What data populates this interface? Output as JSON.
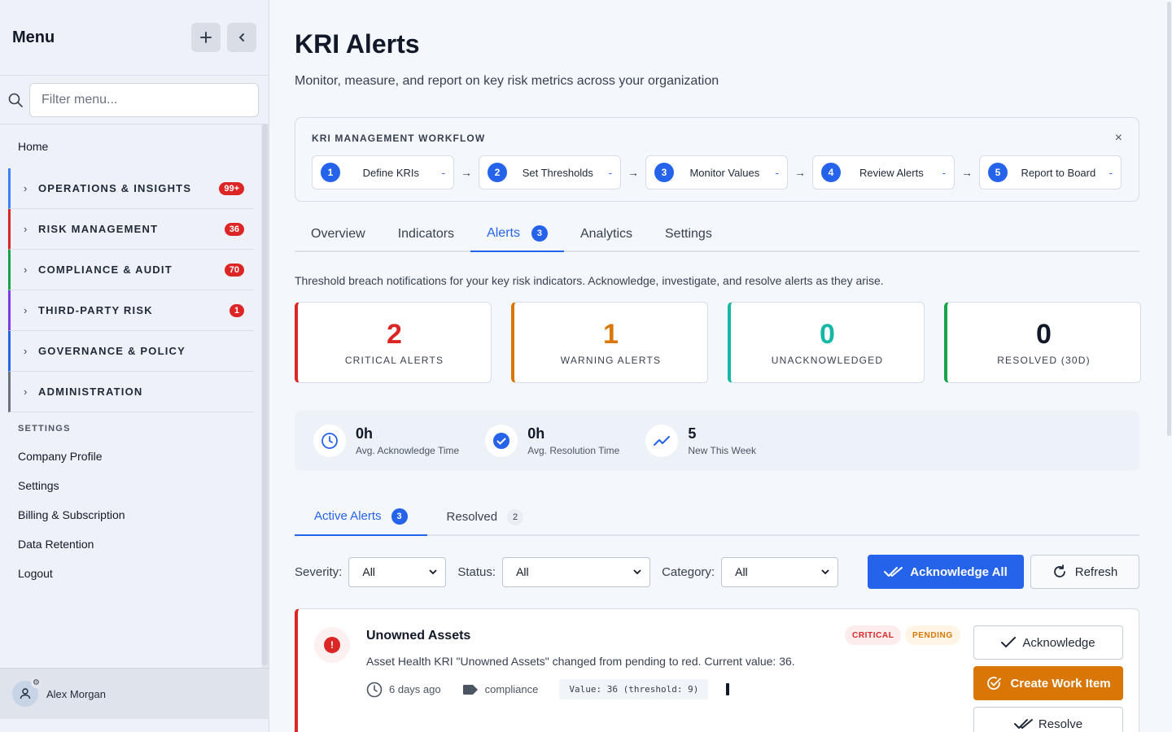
{
  "sidebar": {
    "title": "Menu",
    "filter_placeholder": "Filter menu...",
    "home": "Home",
    "groups": [
      {
        "label": "OPERATIONS & INSIGHTS",
        "badge": "99+",
        "color": "#3b82f6"
      },
      {
        "label": "RISK MANAGEMENT",
        "badge": "36",
        "color": "#dc2626"
      },
      {
        "label": "COMPLIANCE & AUDIT",
        "badge": "70",
        "color": "#16a34a"
      },
      {
        "label": "THIRD-PARTY RISK",
        "badge": "1",
        "color": "#7c3aed"
      },
      {
        "label": "GOVERNANCE & POLICY",
        "badge": "",
        "color": "#2563eb"
      },
      {
        "label": "ADMINISTRATION",
        "badge": "",
        "color": "#6b7280"
      }
    ],
    "settings_header": "SETTINGS",
    "settings_items": [
      "Company Profile",
      "Settings",
      "Billing & Subscription",
      "Data Retention",
      "Logout"
    ],
    "user_name": "Alex Morgan"
  },
  "page": {
    "title": "KRI Alerts",
    "subtitle": "Monitor, measure, and report on key risk metrics across your organization"
  },
  "workflow": {
    "title": "KRI MANAGEMENT WORKFLOW",
    "close": "×",
    "arrow": "→",
    "steps": [
      {
        "num": "1",
        "label": "Define KRIs",
        "status": "-"
      },
      {
        "num": "2",
        "label": "Set Thresholds",
        "status": "-"
      },
      {
        "num": "3",
        "label": "Monitor Values",
        "status": "-"
      },
      {
        "num": "4",
        "label": "Review Alerts",
        "status": "-"
      },
      {
        "num": "5",
        "label": "Report to Board",
        "status": "-"
      }
    ]
  },
  "tabs": [
    {
      "label": "Overview"
    },
    {
      "label": "Indicators"
    },
    {
      "label": "Alerts",
      "count": "3"
    },
    {
      "label": "Analytics"
    },
    {
      "label": "Settings"
    }
  ],
  "description": "Threshold breach notifications for your key risk indicators. Acknowledge, investigate, and resolve alerts as they arise.",
  "stats": [
    {
      "value": "2",
      "label": "CRITICAL ALERTS",
      "color": "#dc2626"
    },
    {
      "value": "1",
      "label": "WARNING ALERTS",
      "color": "#d97706"
    },
    {
      "value": "0",
      "label": "UNACKNOWLEDGED",
      "color": "#14b8a6"
    },
    {
      "value": "0",
      "label": "RESOLVED (30D)",
      "color": "#111827",
      "border": "#16a34a"
    }
  ],
  "metrics": [
    {
      "value": "0h",
      "label": "Avg. Acknowledge Time",
      "icon": "clock-icon"
    },
    {
      "value": "0h",
      "label": "Avg. Resolution Time",
      "icon": "check-circle-icon"
    },
    {
      "value": "5",
      "label": "New This Week",
      "icon": "trend-up-icon"
    }
  ],
  "subtabs": {
    "active": {
      "label": "Active Alerts",
      "count": "3"
    },
    "resolved": {
      "label": "Resolved",
      "count": "2"
    }
  },
  "filters": {
    "severity_label": "Severity:",
    "severity_value": "All",
    "status_label": "Status:",
    "status_value": "All",
    "category_label": "Category:",
    "category_value": "All",
    "ack_all": "Acknowledge All",
    "refresh": "Refresh"
  },
  "alert": {
    "title": "Unowned Assets",
    "message": "Asset Health KRI \"Unowned Assets\" changed from pending to red. Current value: 36.",
    "time": "6 days ago",
    "category": "compliance",
    "value_text": "Value: 36 (threshold: 9)",
    "severity": "CRITICAL",
    "status": "PENDING",
    "acknowledge": "Acknowledge",
    "create_work_item": "Create Work Item",
    "resolve": "Resolve"
  }
}
